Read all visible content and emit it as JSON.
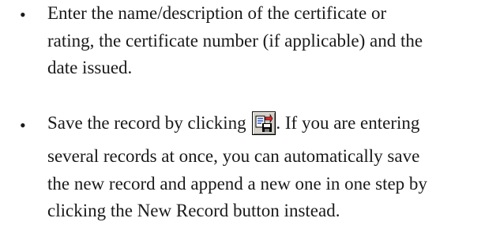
{
  "bullet_symbol": "•",
  "item1": {
    "lines": [
      "Enter the name/description of the certificate or",
      "rating, the certificate number (if applicable) and the",
      "date issued."
    ]
  },
  "item2": {
    "line1_before": "Save the record by clicking",
    "save_icon": "save-record-icon",
    "line1_after": ".  If you are entering",
    "lines": [
      "several records at once, you can automatically save",
      "the new record and append a new one in one step by",
      "clicking the New Record  button instead."
    ]
  }
}
